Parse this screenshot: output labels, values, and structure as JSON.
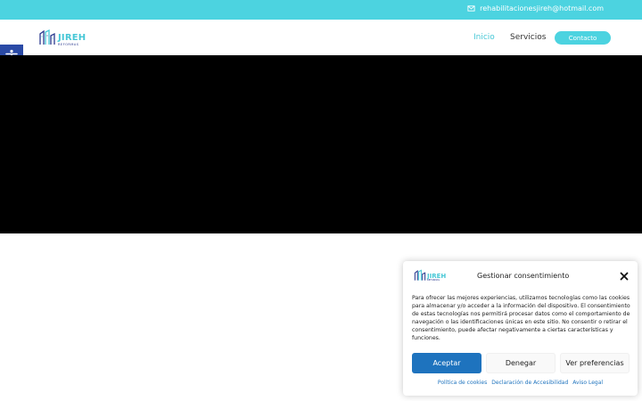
{
  "colors": {
    "accent": "#4cd3e0",
    "brand_dark": "#2b3a8f",
    "accessibility_button": "#2a4aa6",
    "accept_button": "#1e73be"
  },
  "topbar": {
    "email": "rehabilitacionesjireh@hotmail.com",
    "email_icon": "envelope-icon"
  },
  "header": {
    "logo": {
      "name": "JIREH",
      "subtitle": "REFORMAS"
    },
    "nav": {
      "inicio": "Inicio",
      "servicios": "Servicios",
      "contacto": "Contacto"
    }
  },
  "accessibility": {
    "icon": "accessibility-icon"
  },
  "consent": {
    "logo": {
      "name": "JIREH",
      "subtitle": "REFORMAS"
    },
    "title": "Gestionar consentimiento",
    "body": "Para ofrecer las mejores experiencias, utilizamos tecnologías como las cookies para almacenar y/o acceder a la información del dispositivo. El consentimiento de estas tecnologías nos permitirá procesar datos como el comportamiento de navegación o las identificaciones únicas en este sitio. No consentir o retirar el consentimiento, puede afectar negativamente a ciertas características y funciones.",
    "accept": "Aceptar",
    "deny": "Denegar",
    "preferences": "Ver preferencias",
    "links": {
      "cookies": "Política de cookies",
      "accessibility": "Declaración de Accesibilidad",
      "legal": "Aviso Legal"
    }
  }
}
